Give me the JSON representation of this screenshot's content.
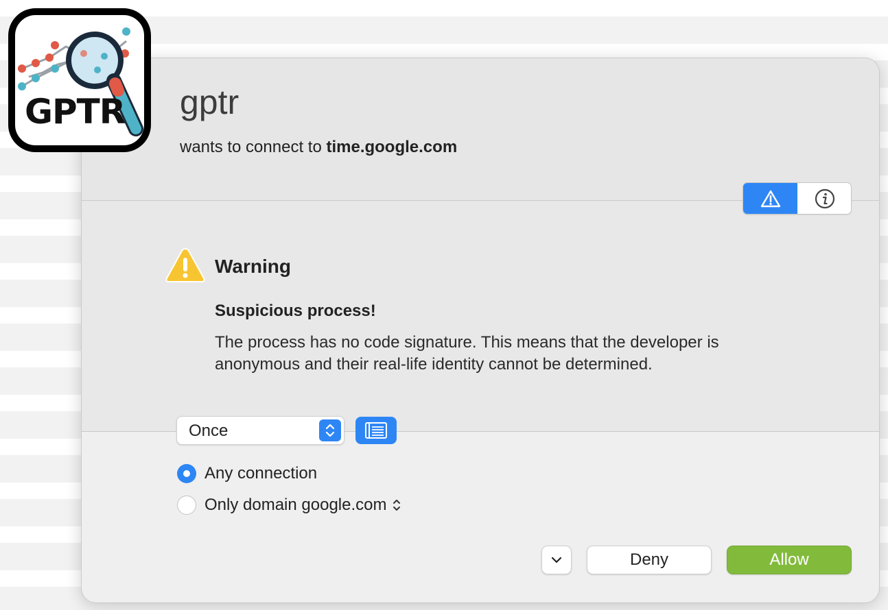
{
  "app": {
    "name": "gptr",
    "icon_text": "GPTR",
    "request_prefix": "wants to connect to",
    "request_host": "time.google.com"
  },
  "tabs": [
    {
      "icon": "warning-icon",
      "selected": true
    },
    {
      "icon": "info-icon",
      "selected": false
    }
  ],
  "warning": {
    "title": "Warning",
    "heading": "Suspicious process!",
    "body": "The process has no code signature. This means that the developer is anonymous and their real-life identity cannot be determined."
  },
  "duration": {
    "selected": "Once"
  },
  "scope": {
    "options": [
      {
        "label": "Any connection",
        "selected": true
      },
      {
        "label": "Only domain google.com",
        "selected": false
      }
    ]
  },
  "actions": {
    "deny": "Deny",
    "allow": "Allow"
  },
  "colors": {
    "accent": "#2e86f5",
    "allow": "#82bb3c",
    "warning": "#f7c531"
  }
}
